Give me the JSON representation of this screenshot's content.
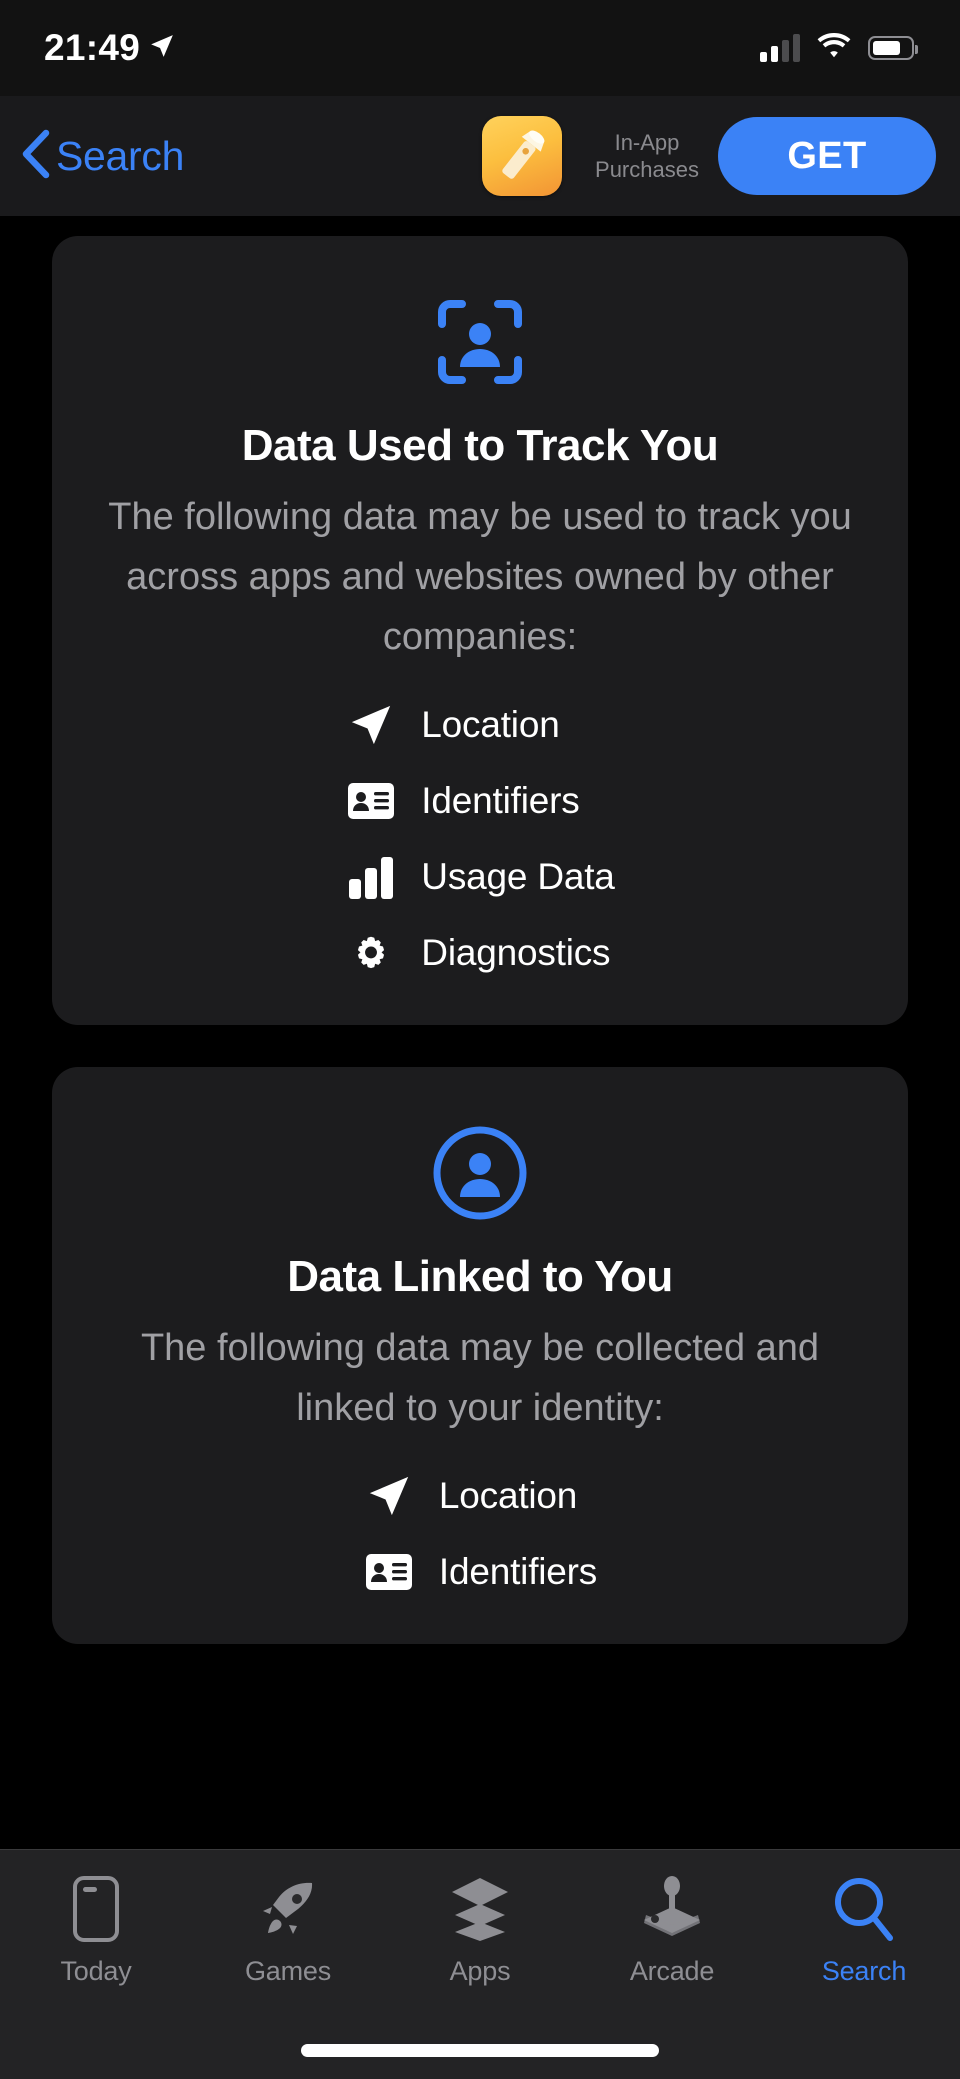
{
  "status_bar": {
    "time": "21:49",
    "location_icon": "location-arrow-icon",
    "cellular_icon": "cellular-signal-icon",
    "wifi_icon": "wifi-icon",
    "battery_icon": "battery-icon"
  },
  "nav_bar": {
    "back_label": "Search",
    "back_icon": "chevron-left-icon",
    "app_icon": "flashlight-app-icon",
    "in_app_purchases_label": "In-App\nPurchases",
    "in_app_line1": "In-App",
    "in_app_line2": "Purchases",
    "get_label": "GET",
    "accent_color": "#3b82f6"
  },
  "cards": [
    {
      "icon": "person-in-viewfinder-icon",
      "title": "Data Used to Track You",
      "description": "The following data may be used to track you across apps and websites owned by other companies:",
      "items": [
        {
          "icon": "location-arrow-icon",
          "label": "Location"
        },
        {
          "icon": "id-card-icon",
          "label": "Identifiers"
        },
        {
          "icon": "bar-chart-icon",
          "label": "Usage Data"
        },
        {
          "icon": "gear-icon",
          "label": "Diagnostics"
        }
      ]
    },
    {
      "icon": "person-circle-icon",
      "title": "Data Linked to You",
      "description": "The following data may be collected and linked to your identity:",
      "items": [
        {
          "icon": "location-arrow-icon",
          "label": "Location"
        },
        {
          "icon": "id-card-icon",
          "label": "Identifiers"
        }
      ]
    }
  ],
  "tab_bar": {
    "items": [
      {
        "label": "Today",
        "icon": "today-phone-icon",
        "active": false
      },
      {
        "label": "Games",
        "icon": "rocket-icon",
        "active": false
      },
      {
        "label": "Apps",
        "icon": "stacked-layers-icon",
        "active": false
      },
      {
        "label": "Arcade",
        "icon": "joystick-icon",
        "active": false
      },
      {
        "label": "Search",
        "icon": "magnifier-icon",
        "active": true
      }
    ],
    "active_color": "#3b82f6",
    "inactive_color": "#8e8e93"
  }
}
